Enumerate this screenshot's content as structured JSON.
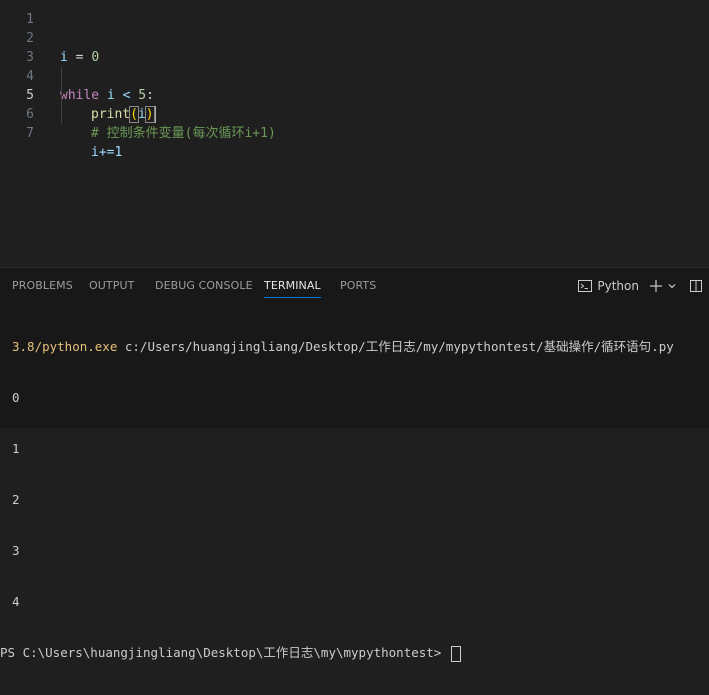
{
  "editor": {
    "lines": [
      {
        "n": "1"
      },
      {
        "n": "2"
      },
      {
        "n": "3"
      },
      {
        "n": "4"
      },
      {
        "n": "5"
      },
      {
        "n": "6"
      },
      {
        "n": "7"
      }
    ],
    "line2": {
      "var": "i",
      "op": " = ",
      "num": "0"
    },
    "line4": {
      "kw": "while",
      "rest": " i < ",
      "num": "5",
      "colon": ":"
    },
    "line5": {
      "fn": "print",
      "open": "(",
      "arg": "i",
      "close": ")"
    },
    "line6": {
      "comment": "# 控制条件变量(每次循环i+1)"
    },
    "line7": {
      "code": "i+=1"
    }
  },
  "panel": {
    "tabs": [
      {
        "label": "PROBLEMS"
      },
      {
        "label": "OUTPUT"
      },
      {
        "label": "DEBUG CONSOLE"
      },
      {
        "label": "TERMINAL"
      },
      {
        "label": "PORTS"
      }
    ],
    "terminal_profile": "Python",
    "icons": [
      "terminal-icon",
      "plus-icon",
      "chevron-down-icon",
      "split-icon"
    ]
  },
  "terminal": {
    "cmd_prefix": "3.8/python.exe",
    "cmd_path": " c:/Users/huangjingliang/Desktop/工作日志/my/mypythontest/基础操作/循环语句.py",
    "outputs": [
      "0",
      "1",
      "2",
      "3",
      "4"
    ],
    "prompt": "PS C:\\Users\\huangjingliang\\Desktop\\工作日志\\my\\mypythontest> "
  },
  "colors": {
    "editor_bg": "#1f1f1f",
    "panel_bg": "#181818",
    "accent": "#0078d4",
    "keyword": "#c586c0",
    "function": "#dcdcaa",
    "variable": "#9cdcfe",
    "number": "#b5cea8",
    "comment": "#6a9955"
  }
}
